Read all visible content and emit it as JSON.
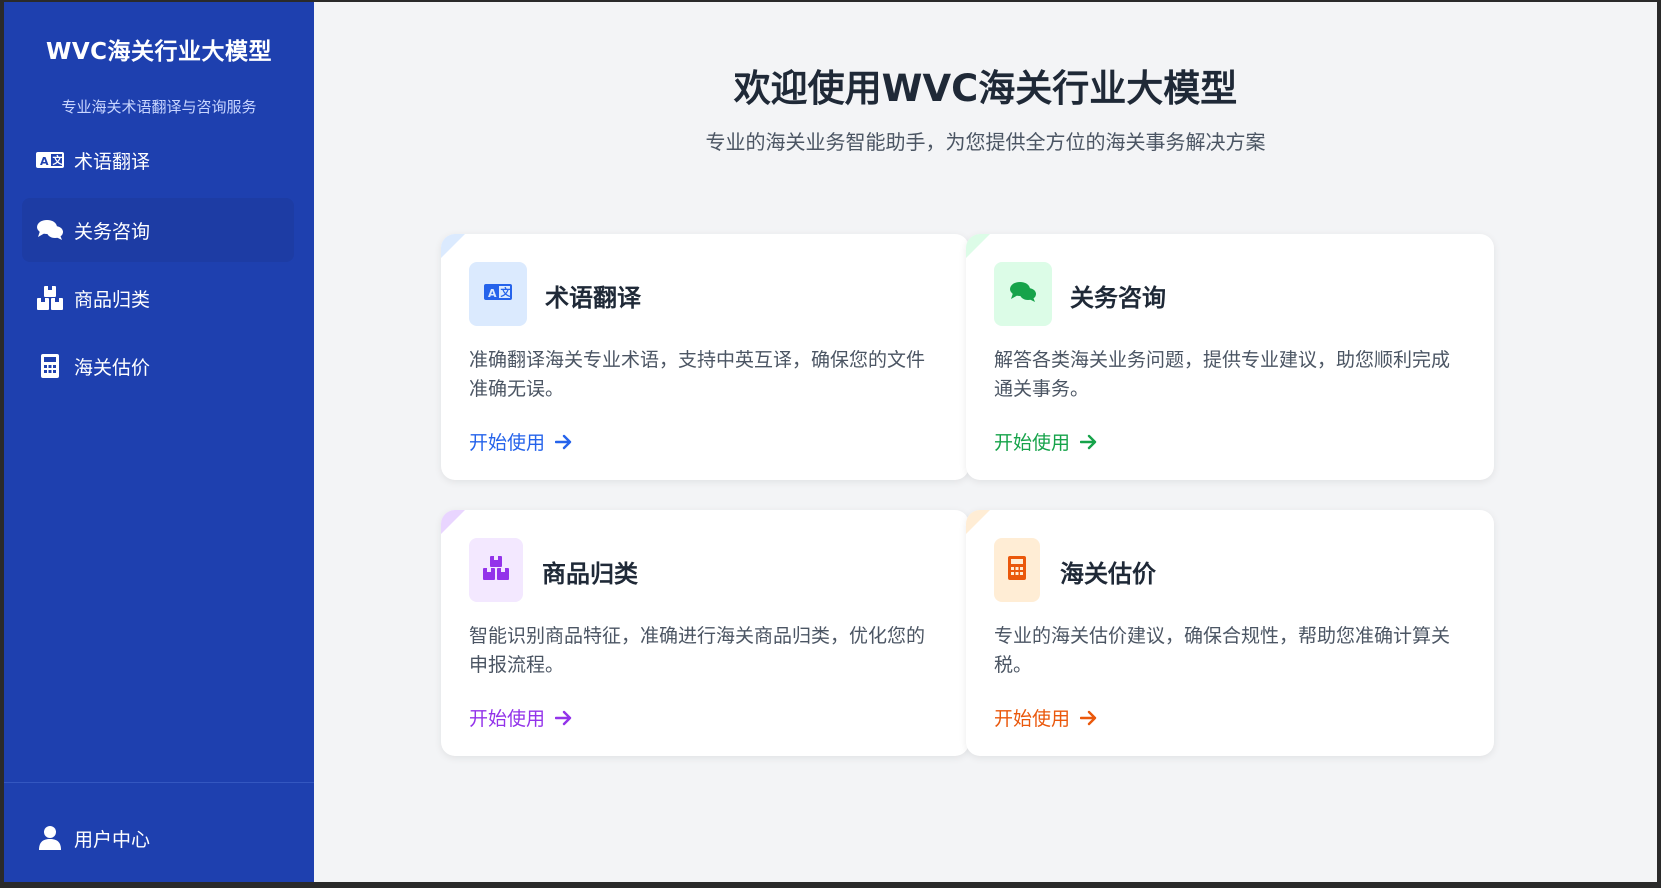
{
  "sidebar": {
    "brand_title": "WVC海关行业大模型",
    "brand_subtitle": "专业海关术语翻译与咨询服务",
    "items": [
      {
        "label": "术语翻译",
        "icon": "translate-icon",
        "active": false
      },
      {
        "label": "关务咨询",
        "icon": "chat-bubbles-icon",
        "active": true
      },
      {
        "label": "商品归类",
        "icon": "boxes-icon",
        "active": false
      },
      {
        "label": "海关估价",
        "icon": "calculator-icon",
        "active": false
      }
    ],
    "user_center": {
      "label": "用户中心",
      "icon": "user-icon"
    }
  },
  "main": {
    "title": "欢迎使用WVC海关行业大模型",
    "subtitle": "专业的海关业务智能助手，为您提供全方位的海关事务解决方案",
    "cards": [
      {
        "title": "术语翻译",
        "description": "准确翻译海关专业术语，支持中英互译，确保您的文件准确无误。",
        "link": "开始使用",
        "icon": "translate-icon",
        "accent": "#2563eb",
        "icon_bg": "#dbeafe"
      },
      {
        "title": "关务咨询",
        "description": "解答各类海关业务问题，提供专业建议，助您顺利完成通关事务。",
        "link": "开始使用",
        "icon": "chat-bubbles-icon",
        "accent": "#16a34a",
        "icon_bg": "#dcfce7"
      },
      {
        "title": "商品归类",
        "description": "智能识别商品特征，准确进行海关商品归类，优化您的申报流程。",
        "link": "开始使用",
        "icon": "boxes-icon",
        "accent": "#9333ea",
        "icon_bg": "#f3e8ff"
      },
      {
        "title": "海关估价",
        "description": "专业的海关估价建议，确保合规性，帮助您准确计算关税。",
        "link": "开始使用",
        "icon": "calculator-icon",
        "accent": "#ea580c",
        "icon_bg": "#ffedd5"
      }
    ]
  },
  "colors": {
    "sidebar_bg": "#1e40af",
    "page_bg": "#f3f4f6"
  }
}
